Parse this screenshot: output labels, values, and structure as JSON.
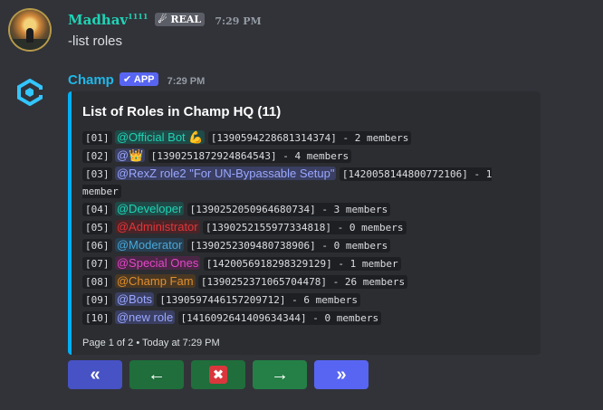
{
  "msg1": {
    "author": "Madhav",
    "author_sup": "1111",
    "badge": "☄ REAL",
    "time": "7:29 PM",
    "text": "-list roles"
  },
  "msg2": {
    "author": "Champ",
    "badge": "✔ APP",
    "time": "7:29 PM"
  },
  "embed": {
    "accent": "#00b0f4",
    "title": "List of Roles in Champ HQ (11)",
    "footer": "Page 1 of 2 • Today at 7:29 PM",
    "rows": [
      {
        "idx": "[01]",
        "role": "@Official Bot 💪",
        "color": "#1fd3b5",
        "bg": "#1f4a47",
        "id": "[1390594228681314374]",
        "count": "- 2 members"
      },
      {
        "idx": "[02]",
        "role": "@👑",
        "color": "#9aa7ff",
        "bg": "#3a3f63",
        "id": "[1390251872924864543]",
        "count": "- 4 members"
      },
      {
        "idx": "[03]",
        "role": "@RexZ role2 \"For UN-Bypassable Setup\"",
        "color": "#9aa7ff",
        "bg": "#3a3f63",
        "id": "[1420058144800772106]",
        "count": "- 1 member"
      },
      {
        "idx": "[04]",
        "role": "@Developer",
        "color": "#1fd3b5",
        "bg": "#1f4a47",
        "id": "[1390252050964680734]",
        "count": "- 3 members"
      },
      {
        "idx": "[05]",
        "role": "@Administrator",
        "color": "#e0353a",
        "bg": "#4a2427",
        "id": "[1390252155977334818]",
        "count": "- 0 members"
      },
      {
        "idx": "[06]",
        "role": "@Moderator",
        "color": "#4aa7d6",
        "bg": "#263f52",
        "id": "[1390252309480738906]",
        "count": "- 0 members"
      },
      {
        "idx": "[07]",
        "role": "@Special Ones",
        "color": "#e048c7",
        "bg": "#4a2645",
        "id": "[1420056918298329129]",
        "count": "- 1 member"
      },
      {
        "idx": "[08]",
        "role": "@Champ Fam",
        "color": "#e08f2e",
        "bg": "#4a3823",
        "id": "[1390252371065704478]",
        "count": "- 26 members"
      },
      {
        "idx": "[09]",
        "role": "@Bots",
        "color": "#9aa7ff",
        "bg": "#3a3f63",
        "id": "[1390597446157209712]",
        "count": "- 6 members"
      },
      {
        "idx": "[10]",
        "role": "@new role",
        "color": "#9aa7ff",
        "bg": "#3a3f63",
        "id": "[1416092641409634344]",
        "count": "- 0 members"
      }
    ]
  },
  "buttons": [
    {
      "name": "first-page-button",
      "label": "«",
      "bg": "#4752c4"
    },
    {
      "name": "prev-page-button",
      "label": "←",
      "bg": "#1f6e3b"
    },
    {
      "name": "close-button",
      "label": "✖",
      "bg": "#1f6e3b"
    },
    {
      "name": "next-page-button",
      "label": "→",
      "bg": "#248046"
    },
    {
      "name": "last-page-button",
      "label": "»",
      "bg": "#5865f2"
    }
  ]
}
